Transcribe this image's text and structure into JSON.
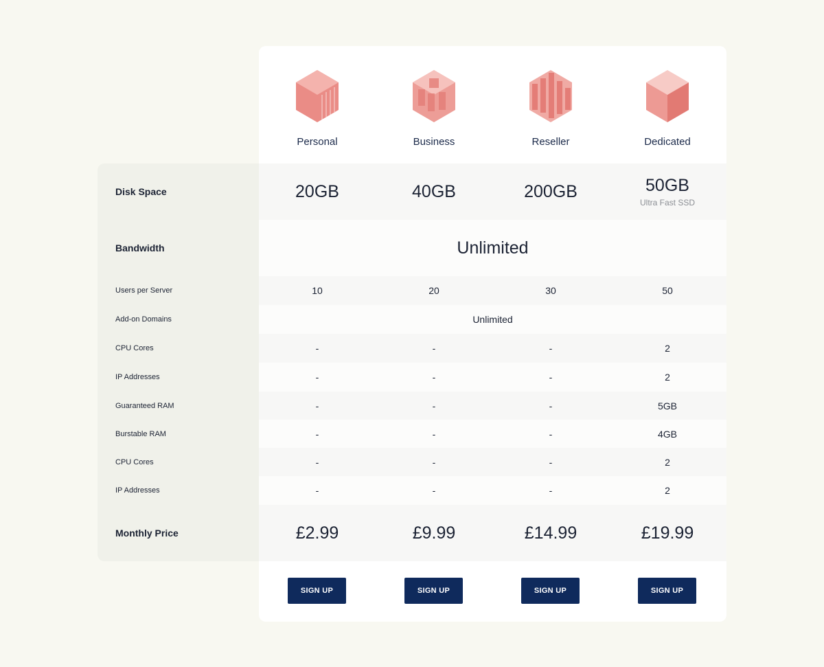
{
  "plans": [
    {
      "name": "Personal",
      "icon": "cube-personal-icon"
    },
    {
      "name": "Business",
      "icon": "cube-business-icon"
    },
    {
      "name": "Reseller",
      "icon": "cube-reseller-icon"
    },
    {
      "name": "Dedicated",
      "icon": "cube-dedicated-icon"
    }
  ],
  "rows": {
    "disk": {
      "label": "Disk Space",
      "values": [
        "20GB",
        "40GB",
        "200GB",
        "50GB"
      ],
      "note": "Ultra Fast SSD"
    },
    "bandwidth": {
      "label": "Bandwidth",
      "value": "Unlimited"
    },
    "users": {
      "label": "Users per Server",
      "values": [
        "10",
        "20",
        "30",
        "50"
      ]
    },
    "addon": {
      "label": "Add-on Domains",
      "value": "Unlimited"
    },
    "cpu1": {
      "label": "CPU Cores",
      "values": [
        "-",
        "-",
        "-",
        "2"
      ]
    },
    "ip1": {
      "label": "IP Addresses",
      "values": [
        "-",
        "-",
        "-",
        "2"
      ]
    },
    "gram": {
      "label": "Guaranteed RAM",
      "values": [
        "-",
        "-",
        "-",
        "5GB"
      ]
    },
    "bram": {
      "label": "Burstable RAM",
      "values": [
        "-",
        "-",
        "-",
        "4GB"
      ]
    },
    "cpu2": {
      "label": "CPU Cores",
      "values": [
        "-",
        "-",
        "-",
        "2"
      ]
    },
    "ip2": {
      "label": "IP Addresses",
      "values": [
        "-",
        "-",
        "-",
        "2"
      ]
    },
    "price": {
      "label": "Monthly Price",
      "values": [
        "£2.99",
        "£9.99",
        "£14.99",
        "£19.99"
      ]
    }
  },
  "signup_label": "SIGN UP",
  "colors": {
    "accent": "#e98a84",
    "button": "#0f2a5c",
    "background": "#f8f8f1"
  }
}
